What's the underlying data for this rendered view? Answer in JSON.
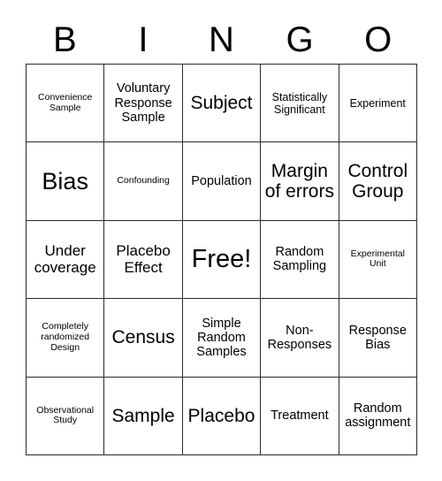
{
  "card": {
    "title_letters": [
      "B",
      "I",
      "N",
      "G",
      "O"
    ],
    "colors": {
      "background": "#ffffff",
      "border": "#2b2b2b",
      "text": "#000000"
    },
    "grid_size": "5x5",
    "rows": [
      [
        {
          "label": "Convenience Sample",
          "size": "xs"
        },
        {
          "label": "Voluntary Response Sample",
          "size": "m"
        },
        {
          "label": "Subject",
          "size": "xl"
        },
        {
          "label": "Statistically Significant",
          "size": "s"
        },
        {
          "label": "Experiment",
          "size": "s"
        }
      ],
      [
        {
          "label": "Bias",
          "size": "xxl"
        },
        {
          "label": "Confounding",
          "size": "xs"
        },
        {
          "label": "Population",
          "size": "m"
        },
        {
          "label": "Margin of errors",
          "size": "xl"
        },
        {
          "label": "Control Group",
          "size": "xl"
        }
      ],
      [
        {
          "label": "Under coverage",
          "size": "l"
        },
        {
          "label": "Placebo Effect",
          "size": "l"
        },
        {
          "label": "Free!",
          "size": "free"
        },
        {
          "label": "Random Sampling",
          "size": "m"
        },
        {
          "label": "Experimental Unit",
          "size": "xs"
        }
      ],
      [
        {
          "label": "Completely randomized Design",
          "size": "xs"
        },
        {
          "label": "Census",
          "size": "xl"
        },
        {
          "label": "Simple Random Samples",
          "size": "m"
        },
        {
          "label": "Non-Responses",
          "size": "m"
        },
        {
          "label": "Response Bias",
          "size": "m"
        }
      ],
      [
        {
          "label": "Observational Study",
          "size": "xs"
        },
        {
          "label": "Sample",
          "size": "xl"
        },
        {
          "label": "Placebo",
          "size": "xl"
        },
        {
          "label": "Treatment",
          "size": "m"
        },
        {
          "label": "Random assignment",
          "size": "m"
        }
      ]
    ]
  }
}
